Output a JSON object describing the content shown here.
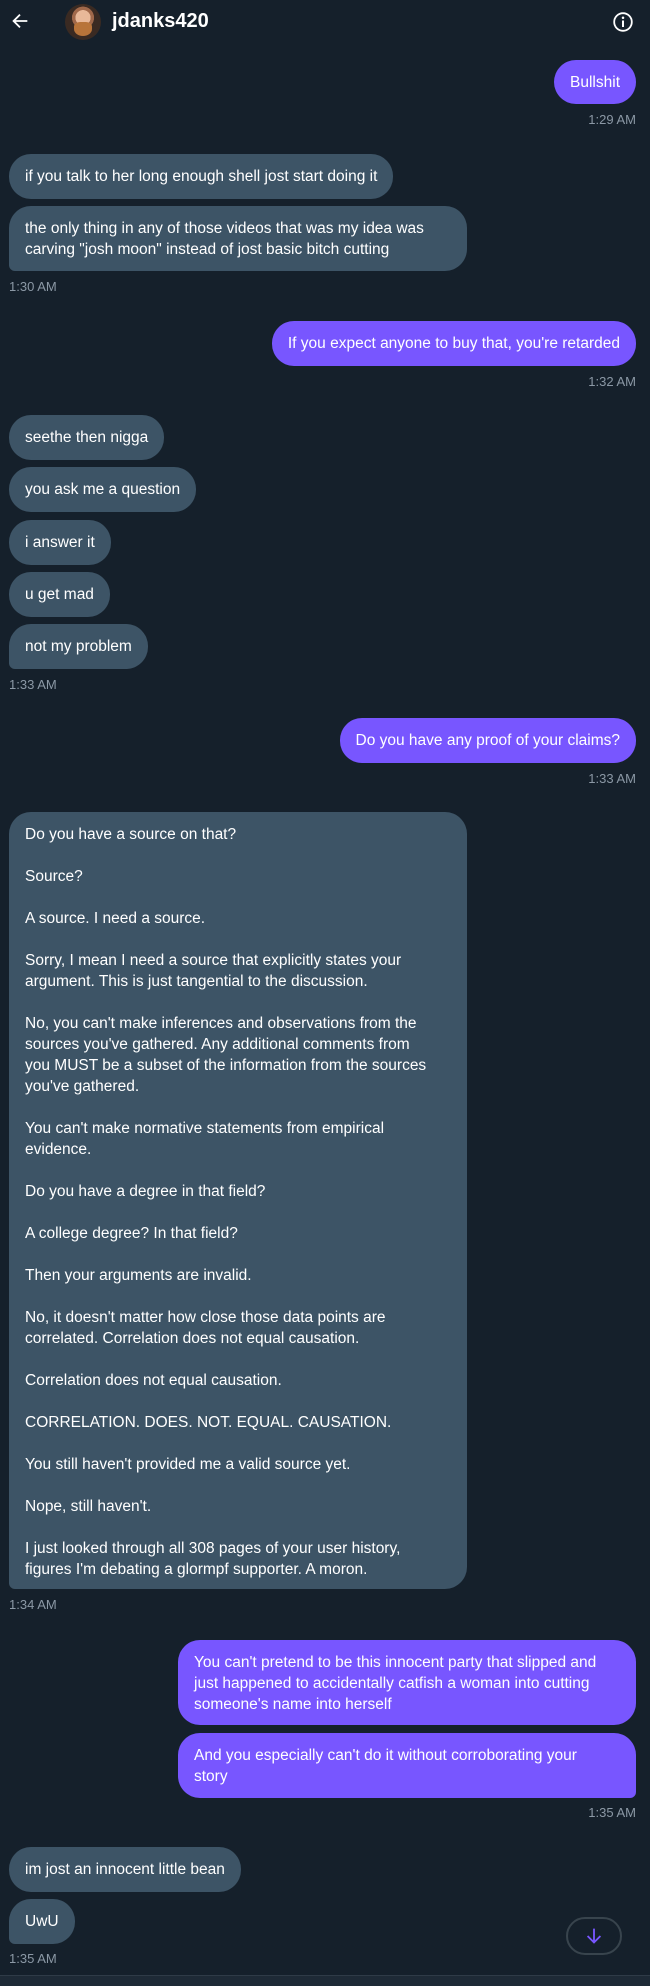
{
  "header": {
    "username": "jdanks420"
  },
  "messages": [
    {
      "id": "m1",
      "side": "out",
      "text": "Bullshit"
    },
    {
      "id": "t1",
      "text": "1:29 AM"
    },
    {
      "id": "m2",
      "side": "in",
      "text": "if you talk to her long enough shell jost start doing it"
    },
    {
      "id": "m3",
      "side": "in",
      "text": "the only thing in any of those videos that was my idea was\ncarving \"josh moon\" instead of jost basic bitch cutting"
    },
    {
      "id": "t2",
      "text": "1:30 AM"
    },
    {
      "id": "m4",
      "side": "out",
      "text": "If you expect anyone to buy that, you're retarded"
    },
    {
      "id": "t3",
      "text": "1:32 AM"
    },
    {
      "id": "m5",
      "side": "in",
      "text": "seethe then nigga"
    },
    {
      "id": "m6",
      "side": "in",
      "text": "you ask me a question"
    },
    {
      "id": "m7",
      "side": "in",
      "text": "i answer it"
    },
    {
      "id": "m8",
      "side": "in",
      "text": "u get mad"
    },
    {
      "id": "m9",
      "side": "in",
      "text": "not my problem"
    },
    {
      "id": "t4",
      "text": "1:33 AM"
    },
    {
      "id": "m10",
      "side": "out",
      "text": "Do you have any proof of your claims?"
    },
    {
      "id": "t5",
      "text": "1:33 AM"
    },
    {
      "id": "m11",
      "side": "in",
      "text": "Do you have a source on that?\n\nSource?\n\nA source. I need a source.\n\nSorry, I mean I need a source that explicitly states your\nargument. This is just tangential to the discussion.\n\nNo, you can't make inferences and observations from the\nsources you've gathered. Any additional comments from\nyou MUST be a subset of the information from the sources\nyou've gathered.\n\nYou can't make normative statements from empirical\nevidence.\n\nDo you have a degree in that field?\n\nA college degree? In that field?\n\nThen your arguments are invalid.\n\nNo, it doesn't matter how close those data points are\ncorrelated. Correlation does not equal causation.\n\nCorrelation does not equal causation.\n\nCORRELATION. DOES. NOT. EQUAL. CAUSATION.\n\nYou still haven't provided me a valid source yet.\n\nNope, still haven't.\n\nI just looked through all 308 pages of your user history,\nfigures I'm debating a glormpf supporter. A moron."
    },
    {
      "id": "t6",
      "text": "1:34 AM"
    },
    {
      "id": "m12",
      "side": "out",
      "text": "You can't pretend to be this innocent party that slipped and\njust happened to accidentally catfish a woman into cutting\nsomeone's name into herself"
    },
    {
      "id": "m13",
      "side": "out",
      "text": "And you especially can't do it without corroborating your\nstory"
    },
    {
      "id": "t7",
      "text": "1:35 AM"
    },
    {
      "id": "m14",
      "side": "in",
      "text": "im jost an innocent little bean"
    },
    {
      "id": "m15",
      "side": "in",
      "text": "UwU"
    },
    {
      "id": "t8",
      "text": "1:35 AM"
    }
  ]
}
